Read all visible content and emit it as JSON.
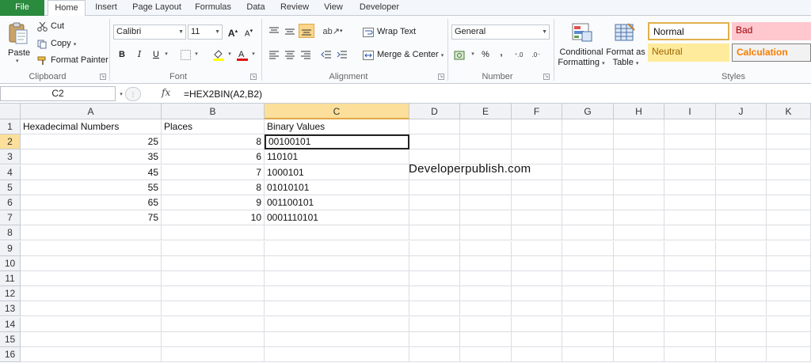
{
  "tabs": [
    "File",
    "Home",
    "Insert",
    "Page Layout",
    "Formulas",
    "Data",
    "Review",
    "View",
    "Developer"
  ],
  "clipboard": {
    "paste": "Paste",
    "cut": "Cut",
    "copy": "Copy",
    "format_painter": "Format Painter",
    "label": "Clipboard"
  },
  "font": {
    "name": "Calibri",
    "size": "11",
    "bold": "B",
    "italic": "I",
    "underline": "U",
    "label": "Font"
  },
  "alignment": {
    "wrap_text": "Wrap Text",
    "merge_center": "Merge & Center",
    "label": "Alignment"
  },
  "number": {
    "format": "General",
    "percent": "%",
    "comma": ",",
    "label": "Number"
  },
  "styles": {
    "conditional_formatting": [
      "Conditional",
      "Formatting"
    ],
    "format_as_table": [
      "Format as",
      "Table"
    ],
    "normal": "Normal",
    "bad": "Bad",
    "neutral": "Neutral",
    "calculation": "Calculation",
    "label": "Styles"
  },
  "formula_bar": {
    "name_box": "C2",
    "fx": "fx",
    "formula": "=HEX2BIN(A2,B2)"
  },
  "columns": [
    "A",
    "B",
    "C",
    "D",
    "E",
    "F",
    "G",
    "H",
    "I",
    "J",
    "K"
  ],
  "rows": [
    "1",
    "2",
    "3",
    "4",
    "5",
    "6",
    "7",
    "8",
    "9",
    "10",
    "11",
    "12",
    "13",
    "14",
    "15",
    "16"
  ],
  "sheet": {
    "headers": [
      "Hexadecimal Numbers",
      "Places",
      "Binary Values"
    ],
    "data": [
      [
        "25",
        "8",
        "00100101"
      ],
      [
        "35",
        "6",
        "110101"
      ],
      [
        "45",
        "7",
        "1000101"
      ],
      [
        "55",
        "8",
        "01010101"
      ],
      [
        "65",
        "9",
        "001100101"
      ],
      [
        "75",
        "10",
        "0001110101"
      ]
    ]
  },
  "watermark": "Developerpublish.com",
  "colors": {
    "file_tab": "#2a8a3e",
    "selection_header": "#fbdf9a",
    "style_normal_border": "#e2b04a",
    "style_bad": "#ffc7ce",
    "style_neutral": "#ffeb9c",
    "style_calculation": "#f2f2f2"
  }
}
